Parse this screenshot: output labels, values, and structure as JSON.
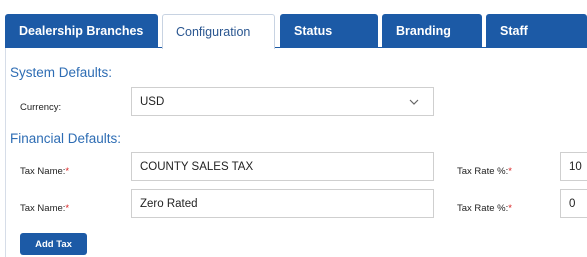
{
  "tabs": [
    {
      "label": "Dealership Branches",
      "active": false
    },
    {
      "label": "Configuration",
      "active": true
    },
    {
      "label": "Status",
      "active": false
    },
    {
      "label": "Branding",
      "active": false
    },
    {
      "label": "Staff",
      "active": false
    }
  ],
  "system_defaults": {
    "title": "System Defaults:",
    "currency_label": "Currency:",
    "currency_value": "USD",
    "dropdown_icon": "chevron-down-icon"
  },
  "financial_defaults": {
    "title": "Financial Defaults:",
    "taxes": [
      {
        "name_label": "Tax Name:",
        "name_value": "COUNTY SALES TAX",
        "rate_label": "Tax Rate %:",
        "rate_value": "10"
      },
      {
        "name_label": "Tax Name:",
        "name_value": "Zero Rated",
        "rate_label": "Tax Rate %:",
        "rate_value": "0"
      }
    ],
    "required_marker": "*",
    "add_button_label": "Add Tax"
  },
  "colors": {
    "tab_blue": "#1c5aa6",
    "section_title": "#2e6db4",
    "required": "#d82020"
  }
}
